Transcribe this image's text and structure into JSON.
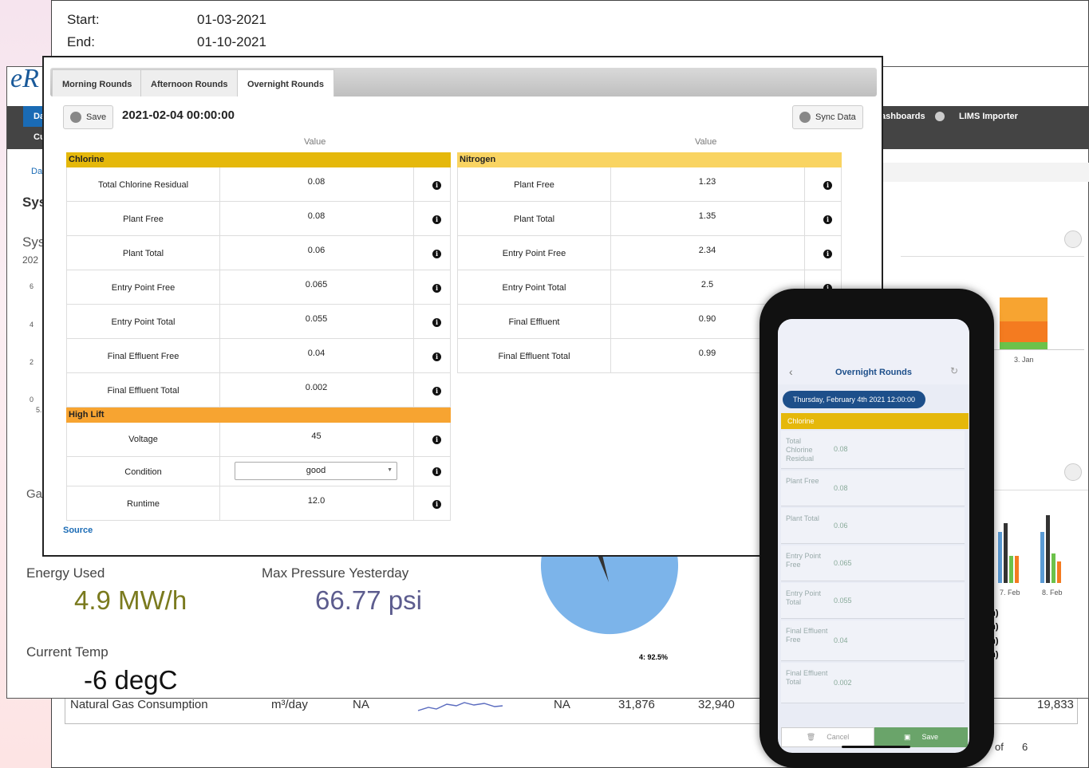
{
  "back": {
    "start_label": "Start:",
    "start_value": "01-03-2021",
    "end_label": "End:",
    "end_value": "01-10-2021",
    "table_row": {
      "name": "Natural Gas Consumption",
      "unit": "m³/day",
      "c1": "NA",
      "c2": "NA",
      "c3": "31,876",
      "c4": "32,940",
      "c5": "19,833"
    },
    "pager": {
      "of_label": "of",
      "total": "6"
    }
  },
  "dashboard": {
    "logo": "eR",
    "nav": {
      "dashboards": "ashboards",
      "lims": "LIMS Importer"
    },
    "left_fragments": {
      "da1": "Da",
      "cu": "Cu",
      "da2": "Da",
      "sys1": "Sys",
      "sys2": "Sys",
      "year": "202",
      "ga": "Ga",
      "five": "5."
    },
    "y_ticks": [
      "6",
      "4",
      "2",
      "0"
    ],
    "kpis": {
      "energy_label": "Energy Used",
      "energy_value": "4.9 MW/h",
      "energy_color": "#7a7a1e",
      "pressure_label": "Max Pressure Yesterday",
      "pressure_value": "66.77 psi",
      "pressure_color": "#5c5c8e",
      "temp_label": "Current Temp",
      "temp_value": "-6 degC",
      "temp_color": "#111111"
    },
    "pie_label": "4: 92.5%",
    "bar_labels": {
      "jan": "3. Jan",
      "feb7": "7. Feb",
      "feb8": "8. Feb"
    },
    "legend": [
      "V (m)",
      "V (m)",
      "V (m)",
      "V (m)"
    ]
  },
  "modal": {
    "tabs": [
      "Morning Rounds",
      "Afternoon Rounds",
      "Overnight Rounds"
    ],
    "active_tab": 2,
    "save_label": "Save",
    "timestamp": "2021-02-04 00:00:00",
    "sync_label": "Sync Data",
    "value_header": "Value",
    "chlorine": {
      "title": "Chlorine",
      "color": "#e5b80b",
      "rows": [
        {
          "label": "Total Chlorine Residual",
          "value": "0.08"
        },
        {
          "label": "Plant Free",
          "value": "0.08"
        },
        {
          "label": "Plant Total",
          "value": "0.06"
        },
        {
          "label": "Entry Point Free",
          "value": "0.065"
        },
        {
          "label": "Entry Point Total",
          "value": "0.055"
        },
        {
          "label": "Final Effluent Free",
          "value": "0.04"
        },
        {
          "label": "Final Effluent Total",
          "value": "0.002"
        }
      ]
    },
    "high_lift": {
      "title": "High Lift",
      "color": "#f7a431",
      "voltage_label": "Voltage",
      "voltage_value": "45",
      "condition_label": "Condition",
      "condition_value": "good",
      "runtime_label": "Runtime",
      "runtime_value": "12.0"
    },
    "nitrogen": {
      "title": "Nitrogen",
      "color": "#f9d462",
      "rows": [
        {
          "label": "Plant Free",
          "value": "1.23"
        },
        {
          "label": "Plant Total",
          "value": "1.35"
        },
        {
          "label": "Entry Point Free",
          "value": "2.34"
        },
        {
          "label": "Entry Point Total",
          "value": "2.5"
        },
        {
          "label": "Final Effluent",
          "value": "0.90"
        },
        {
          "label": "Final Effluent Total",
          "value": "0.99"
        }
      ]
    },
    "source_link": "Source"
  },
  "phone": {
    "title": "Overnight Rounds",
    "date_pill": "Thursday, February 4th 2021 12:00:00",
    "section": "Chlorine",
    "fields": [
      {
        "label": "Total Chlorine Residual",
        "value": "0.08"
      },
      {
        "label": "Plant Free",
        "value": "0.08"
      },
      {
        "label": "Plant Total",
        "value": "0.06"
      },
      {
        "label": "Entry Point Free",
        "value": "0.065"
      },
      {
        "label": "Entry Point Total",
        "value": "0.055"
      },
      {
        "label": "Final Effluent Free",
        "value": "0.04"
      },
      {
        "label": "Final Effluent Total",
        "value": "0.002"
      }
    ],
    "cancel_label": "Cancel",
    "save_label": "Save"
  }
}
